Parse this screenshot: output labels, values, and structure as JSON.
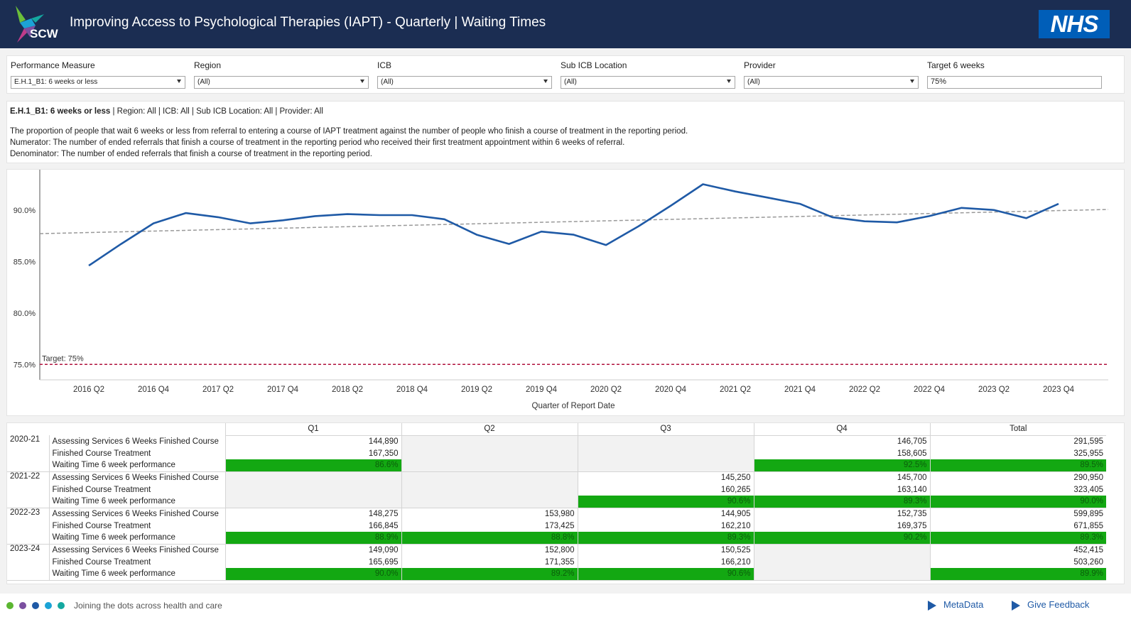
{
  "header": {
    "logo_text": "SCW",
    "title": "Improving Access to Psychological Therapies (IAPT) - Quarterly | Waiting Times",
    "nhs_logo": "NHS"
  },
  "filters": [
    {
      "label": "Performance Measure",
      "value": "E.H.1_B1: 6 weeks or less",
      "type": "select"
    },
    {
      "label": "Region",
      "value": "(All)",
      "type": "select"
    },
    {
      "label": "ICB",
      "value": "(All)",
      "type": "select"
    },
    {
      "label": "Sub ICB Location",
      "value": "(All)",
      "type": "select"
    },
    {
      "label": "Provider",
      "value": "(All)",
      "type": "select"
    },
    {
      "label": "Target 6 weeks",
      "value": "75%",
      "type": "text"
    }
  ],
  "description": {
    "measure": "E.H.1_B1: 6 weeks or less",
    "filter_summary": " | Region: All | ICB: All | Sub ICB Location: All | Provider: All",
    "line1": "The proportion of people that wait 6 weeks or less from referral to entering a course of IAPT treatment against the number of people who finish a course of treatment in the reporting period.",
    "line2": "Numerator: The number of ended referrals that finish a course of treatment in the reporting period who received their first treatment appointment within 6 weeks of referral.",
    "line3": "Denominator: The number of ended referrals that finish a course of treatment in the reporting period."
  },
  "chart_data": {
    "type": "line",
    "xlabel": "Quarter of Report Date",
    "ylabel": "",
    "ylim": [
      73.5,
      93.5
    ],
    "yticks": [
      75,
      80,
      85,
      90
    ],
    "ytick_labels": [
      "75.0%",
      "80.0%",
      "85.0%",
      "90.0%"
    ],
    "x_tick_labels": [
      "2016 Q2",
      "2016 Q4",
      "2017 Q2",
      "2017 Q4",
      "2018 Q2",
      "2018 Q4",
      "2019 Q2",
      "2019 Q4",
      "2020 Q2",
      "2020 Q4",
      "2021 Q2",
      "2021 Q4",
      "2022 Q2",
      "2022 Q4",
      "2023 Q2",
      "2023 Q4"
    ],
    "x": [
      "2016 Q2",
      "2016 Q3",
      "2016 Q4",
      "2017 Q1",
      "2017 Q2",
      "2017 Q3",
      "2017 Q4",
      "2018 Q1",
      "2018 Q2",
      "2018 Q3",
      "2018 Q4",
      "2019 Q1",
      "2019 Q2",
      "2019 Q3",
      "2019 Q4",
      "2020 Q1",
      "2020 Q2",
      "2020 Q3",
      "2020 Q4",
      "2021 Q1",
      "2021 Q2",
      "2021 Q3",
      "2021 Q4",
      "2022 Q1",
      "2022 Q2",
      "2022 Q3",
      "2022 Q4",
      "2023 Q1",
      "2023 Q2",
      "2023 Q3",
      "2023 Q4",
      "2024 Q1"
    ],
    "series": [
      {
        "values": [
          84.6,
          86.7,
          88.7,
          89.7,
          89.3,
          88.7,
          89.0,
          89.4,
          89.6,
          89.5,
          89.5,
          89.1,
          87.6,
          86.7,
          87.9,
          87.6,
          86.6,
          88.4,
          90.4,
          92.5,
          91.8,
          91.2,
          90.6,
          89.3,
          88.9,
          88.8,
          89.4,
          90.2,
          90.0,
          89.2,
          90.6
        ],
        "color": "#1f5aa6"
      }
    ],
    "trend": {
      "start": 87.7,
      "end": 90.05,
      "color": "#999999"
    },
    "target": {
      "value": 75,
      "label": "Target: 75%",
      "color": "#b0103c"
    },
    "grid": false,
    "legend": "none"
  },
  "table": {
    "columns": [
      "Q1",
      "Q2",
      "Q3",
      "Q4",
      "Total"
    ],
    "years": [
      {
        "year": "2020-21",
        "rows": [
          {
            "metric": "Assessing Services 6 Weeks Finished Course",
            "values": [
              "144,890",
              "",
              "",
              "146,705",
              "291,595"
            ]
          },
          {
            "metric": "Finished Course Treatment",
            "values": [
              "167,350",
              "",
              "",
              "158,605",
              "325,955"
            ]
          },
          {
            "metric": "Waiting Time 6 week performance",
            "values": [
              "86.6%",
              "",
              "",
              "92.5%",
              "89.5%"
            ]
          }
        ]
      },
      {
        "year": "2021-22",
        "rows": [
          {
            "metric": "Assessing Services 6 Weeks Finished Course",
            "values": [
              "",
              "",
              "145,250",
              "145,700",
              "290,950"
            ]
          },
          {
            "metric": "Finished Course Treatment",
            "values": [
              "",
              "",
              "160,265",
              "163,140",
              "323,405"
            ]
          },
          {
            "metric": "Waiting Time 6 week performance",
            "values": [
              "",
              "",
              "90.6%",
              "89.3%",
              "90.0%"
            ]
          }
        ]
      },
      {
        "year": "2022-23",
        "rows": [
          {
            "metric": "Assessing Services 6 Weeks Finished Course",
            "values": [
              "148,275",
              "153,980",
              "144,905",
              "152,735",
              "599,895"
            ]
          },
          {
            "metric": "Finished Course Treatment",
            "values": [
              "166,845",
              "173,425",
              "162,210",
              "169,375",
              "671,855"
            ]
          },
          {
            "metric": "Waiting Time 6 week performance",
            "values": [
              "88.9%",
              "88.8%",
              "89.3%",
              "90.2%",
              "89.3%"
            ]
          }
        ]
      },
      {
        "year": "2023-24",
        "rows": [
          {
            "metric": "Assessing Services 6 Weeks Finished Course",
            "values": [
              "149,090",
              "152,800",
              "150,525",
              "",
              "452,415"
            ]
          },
          {
            "metric": "Finished Course Treatment",
            "values": [
              "165,695",
              "171,355",
              "166,210",
              "",
              "503,260"
            ]
          },
          {
            "metric": "Waiting Time 6 week performance",
            "values": [
              "90.0%",
              "89.2%",
              "90.6%",
              "",
              "89.9%"
            ]
          }
        ]
      }
    ]
  },
  "footer": {
    "tagline": "Joining the dots across health and care",
    "dots": [
      "#5bb631",
      "#7b4fa0",
      "#1f5aa6",
      "#1ba3d6",
      "#14a8a0"
    ],
    "links": [
      "MetaData",
      "Give Feedback"
    ]
  }
}
